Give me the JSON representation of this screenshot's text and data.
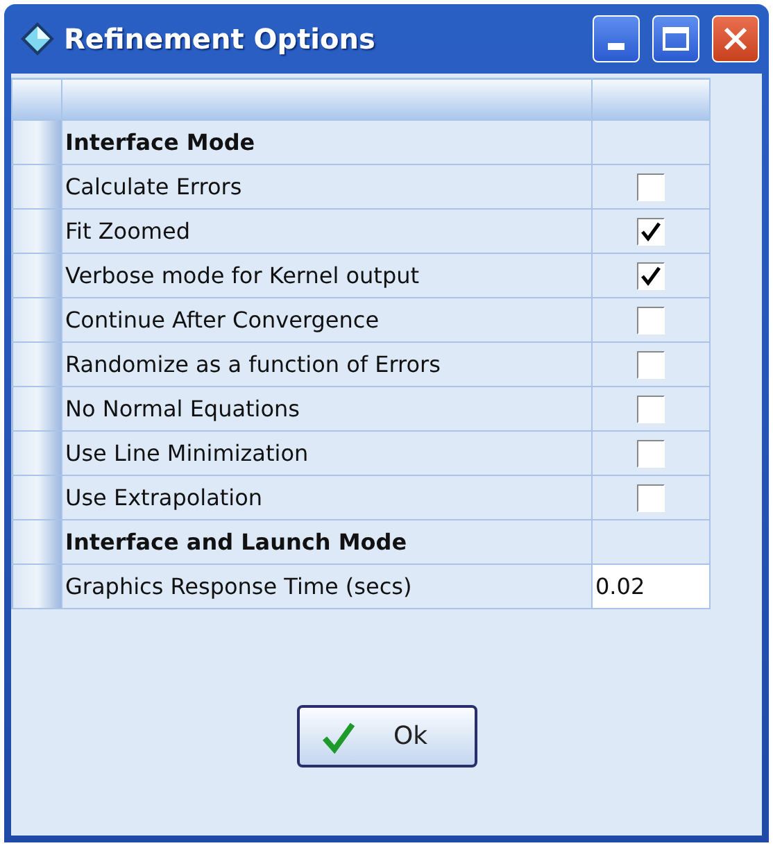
{
  "window": {
    "title": "Refinement Options"
  },
  "rows": [
    {
      "kind": "section",
      "label": "Interface Mode"
    },
    {
      "kind": "check",
      "label": "Calculate Errors",
      "checked": false
    },
    {
      "kind": "check",
      "label": "Fit Zoomed",
      "checked": true
    },
    {
      "kind": "check",
      "label": "Verbose mode for Kernel output",
      "checked": true
    },
    {
      "kind": "check",
      "label": "Continue After Convergence",
      "checked": false
    },
    {
      "kind": "check",
      "label": "Randomize as a function of Errors",
      "checked": false
    },
    {
      "kind": "check",
      "label": "No Normal Equations",
      "checked": false
    },
    {
      "kind": "check",
      "label": "Use Line Minimization",
      "checked": false
    },
    {
      "kind": "check",
      "label": "Use Extrapolation",
      "checked": false
    },
    {
      "kind": "section",
      "label": "Interface and Launch Mode"
    },
    {
      "kind": "value",
      "label": "Graphics Response Time (secs)",
      "value": "0.02"
    }
  ],
  "buttons": [
    {
      "label": "Ok"
    }
  ]
}
